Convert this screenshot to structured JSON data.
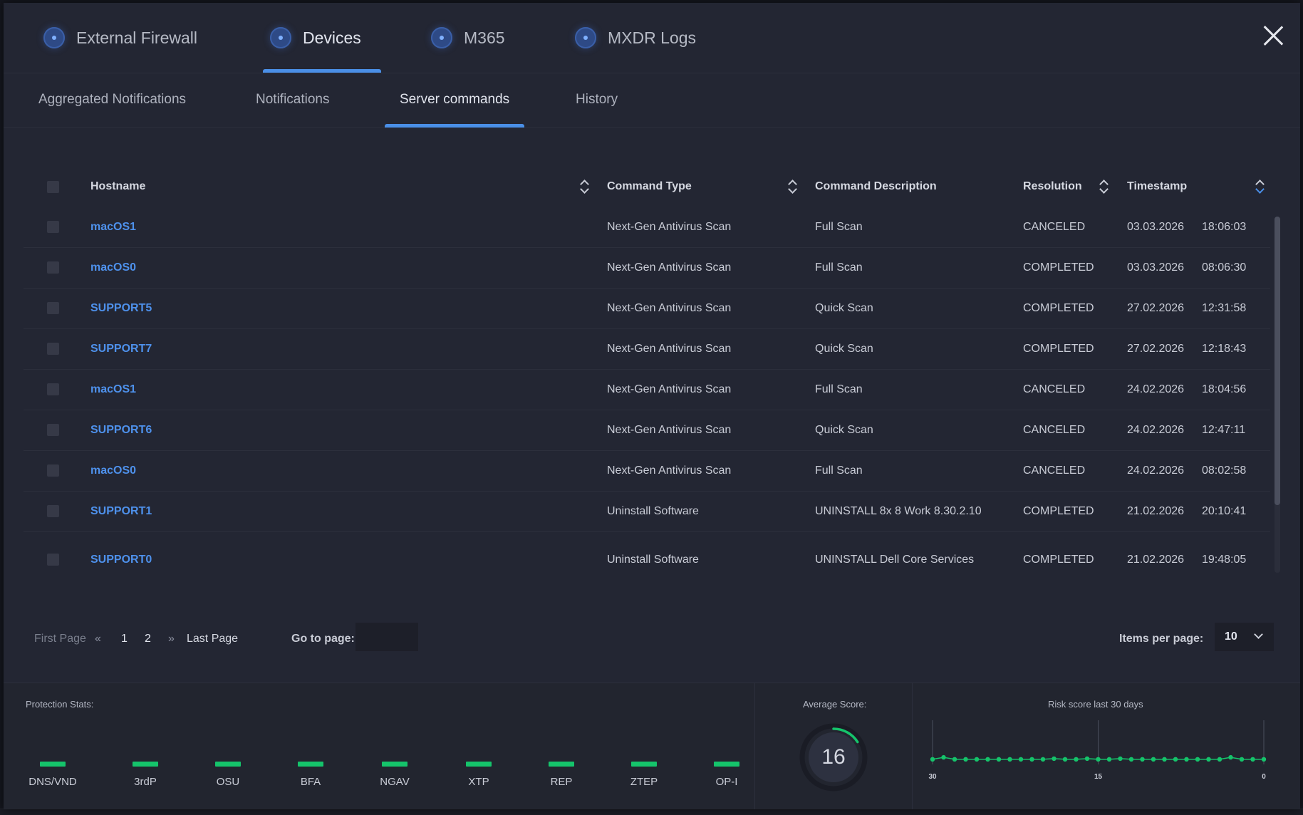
{
  "top_tabs": [
    {
      "label": "External Firewall",
      "active": false
    },
    {
      "label": "Devices",
      "active": true
    },
    {
      "label": "M365",
      "active": false
    },
    {
      "label": "MXDR Logs",
      "active": false
    }
  ],
  "sub_tabs": [
    {
      "label": "Aggregated Notifications",
      "active": false
    },
    {
      "label": "Notifications",
      "active": false
    },
    {
      "label": "Server commands",
      "active": true
    },
    {
      "label": "History",
      "active": false
    }
  ],
  "table": {
    "columns": {
      "hostname": "Hostname",
      "command_type": "Command Type",
      "command_description": "Command Description",
      "resolution": "Resolution",
      "timestamp": "Timestamp"
    },
    "rows": [
      {
        "hostname": "macOS1",
        "command_type": "Next-Gen Antivirus Scan",
        "description": "Full Scan",
        "resolution": "CANCELED",
        "date": "03.03.2026",
        "time": "18:06:03"
      },
      {
        "hostname": "macOS0",
        "command_type": "Next-Gen Antivirus Scan",
        "description": "Full Scan",
        "resolution": "COMPLETED",
        "date": "03.03.2026",
        "time": "08:06:30"
      },
      {
        "hostname": "SUPPORT5",
        "command_type": "Next-Gen Antivirus Scan",
        "description": "Quick Scan",
        "resolution": "COMPLETED",
        "date": "27.02.2026",
        "time": "12:31:58"
      },
      {
        "hostname": "SUPPORT7",
        "command_type": "Next-Gen Antivirus Scan",
        "description": "Quick Scan",
        "resolution": "COMPLETED",
        "date": "27.02.2026",
        "time": "12:18:43"
      },
      {
        "hostname": "macOS1",
        "command_type": "Next-Gen Antivirus Scan",
        "description": "Full Scan",
        "resolution": "CANCELED",
        "date": "24.02.2026",
        "time": "18:04:56"
      },
      {
        "hostname": "SUPPORT6",
        "command_type": "Next-Gen Antivirus Scan",
        "description": "Quick Scan",
        "resolution": "CANCELED",
        "date": "24.02.2026",
        "time": "12:47:11"
      },
      {
        "hostname": "macOS0",
        "command_type": "Next-Gen Antivirus Scan",
        "description": "Full Scan",
        "resolution": "CANCELED",
        "date": "24.02.2026",
        "time": "08:02:58"
      },
      {
        "hostname": "SUPPORT1",
        "command_type": "Uninstall Software",
        "description": "UNINSTALL 8x 8 Work 8.30.2.10",
        "resolution": "COMPLETED",
        "date": "21.02.2026",
        "time": "20:10:41"
      },
      {
        "hostname": "SUPPORT0",
        "command_type": "Uninstall Software",
        "description": "UNINSTALL Dell Core Services",
        "resolution": "COMPLETED",
        "date": "21.02.2026",
        "time": "19:48:05"
      }
    ]
  },
  "pagination": {
    "first_page": "First Page",
    "pages": [
      "1",
      "2"
    ],
    "last_page": "Last Page",
    "goto_label": "Go to page:",
    "goto_value": "",
    "items_per_page_label": "Items per page:",
    "items_per_page_value": "10"
  },
  "protection_stats": {
    "title": "Protection Stats:",
    "items": [
      "DNS/VND",
      "3rdP",
      "OSU",
      "BFA",
      "NGAV",
      "XTP",
      "REP",
      "ZTEP",
      "OP-I"
    ],
    "status_color": "#15c46b"
  },
  "average_score": {
    "title": "Average Score:",
    "value": "16",
    "max": 100,
    "ring_color": "#15c46b"
  },
  "risk_chart": {
    "title": "Risk score last 30 days",
    "x_ticks": [
      "30",
      "15",
      "0"
    ],
    "chart_data": {
      "type": "line",
      "x": [
        30,
        29,
        28,
        27,
        26,
        25,
        24,
        23,
        22,
        21,
        20,
        19,
        18,
        17,
        16,
        15,
        14,
        13,
        12,
        11,
        10,
        9,
        8,
        7,
        6,
        5,
        4,
        3,
        2,
        1,
        0
      ],
      "values": [
        16,
        22,
        16,
        16,
        16,
        16,
        16,
        16,
        16,
        16,
        16,
        18,
        16,
        16,
        18,
        16,
        16,
        18,
        16,
        16,
        16,
        16,
        16,
        16,
        16,
        16,
        16,
        22,
        16,
        16,
        16
      ],
      "x_reversed": true,
      "grid_x": [
        30,
        15,
        0
      ],
      "color": "#15c46b"
    }
  }
}
